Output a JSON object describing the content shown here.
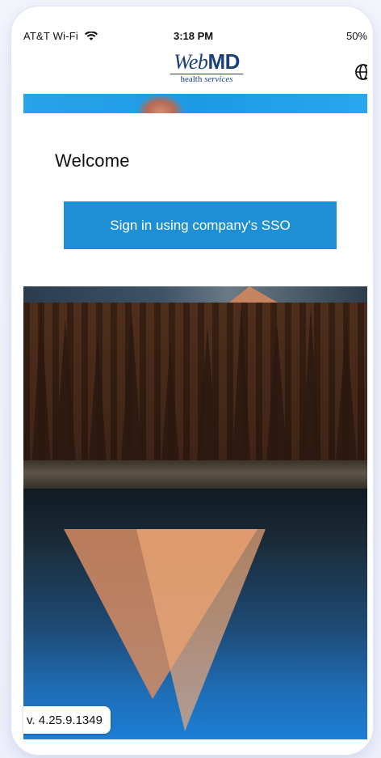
{
  "status_bar": {
    "carrier": "AT&T Wi-Fi",
    "time": "3:18 PM",
    "battery": "50%"
  },
  "header": {
    "logo_web": "Web",
    "logo_md": "MD",
    "logo_sub_a": "health ",
    "logo_sub_b": "services",
    "globe_icon": "globe-icon"
  },
  "welcome": {
    "title": "Welcome",
    "sso_button_label": "Sign in using company's SSO"
  },
  "version": "v. 4.25.9.1349",
  "colors": {
    "button": "#1e8fd4",
    "logo": "#1b3f7a"
  }
}
